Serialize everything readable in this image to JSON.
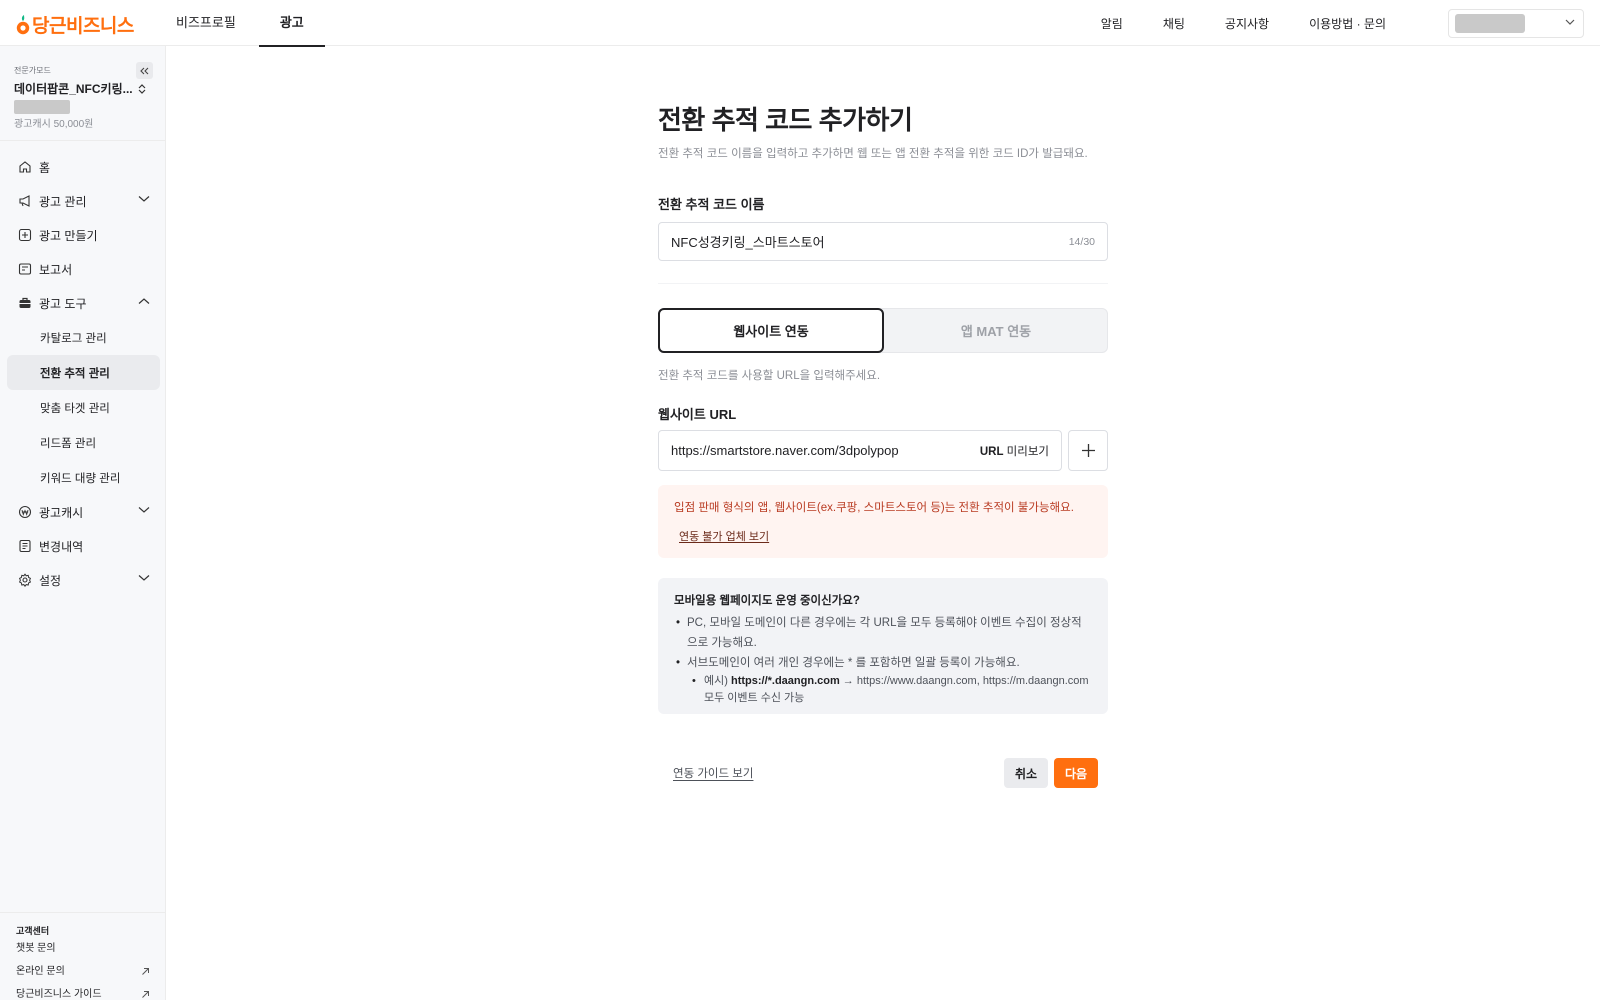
{
  "brand": {
    "name": "당근비즈니스",
    "accent": "#ff6f0f"
  },
  "topnav": {
    "items": [
      "비즈프로필",
      "광고"
    ],
    "active": "광고"
  },
  "toplinks": [
    "알림",
    "채팅",
    "공지사항",
    "이용방법 · 문의"
  ],
  "sidebar": {
    "mode": "전문가모드",
    "account": "데이터팝콘_NFC키링...",
    "cash": "광고캐시 50,000원",
    "menu": {
      "home": "홈",
      "ad_manage": "광고 관리",
      "ad_create": "광고 만들기",
      "report": "보고서",
      "ad_tools": "광고 도구",
      "catalog": "카탈로그 관리",
      "conversion": "전환 추적 관리",
      "target": "맞춤 타겟 관리",
      "leadform": "리드폼 관리",
      "keyword": "키워드 대량 관리",
      "ad_cash": "광고캐시",
      "history": "변경내역",
      "settings": "설정"
    },
    "support": {
      "title": "고객센터",
      "chatbot": "챗봇 문의",
      "online": "온라인 문의",
      "guide": "당근비즈니스 가이드"
    }
  },
  "main": {
    "title": "전환 추적 코드 추가하기",
    "description": "전환 추적 코드 이름을 입력하고 추가하면 웹 또는 앱 전환 추적을 위한 코드 ID가 발급돼요.",
    "name_label": "전환 추적 코드 이름",
    "name_value": "NFC성경키링_스마트스토어",
    "name_count": "14/30",
    "tabs": {
      "website": "웹사이트 연동",
      "app": "앱 MAT 연동"
    },
    "url_hint": "전환 추적 코드를 사용할 URL을 입력해주세요.",
    "url_label": "웹사이트 URL",
    "url_value": "https://smartstore.naver.com/3dpolypop",
    "url_preview_bold": "URL",
    "url_preview_rest": " 미리보기",
    "warning": "입점 판매 형식의 앱, 웹사이트(ex.쿠팡, 스마트스토어 등)는 전환 추적이 불가능해요.",
    "warning_link": "연동 불가 업체 보기",
    "info_title": "모바일용 웹페이지도 운영 중이신가요?",
    "info_bullet1": "PC, 모바일 도메인이 다른 경우에는 각 URL을 모두 등록해야 이벤트 수집이 정상적으로 가능해요.",
    "info_bullet2": "서브도메인이 여러 개인 경우에는 * 를 포함하면 일괄 등록이 가능해요.",
    "info_sub_prefix": "예시) ",
    "info_sub_bold": "https://*.daangn.com",
    "info_sub_rest": " → https://www.daangn.com, https://m.daangn.com 모두 이벤트 수신 가능",
    "guide_link": "연동 가이드 보기",
    "cancel": "취소",
    "next": "다음"
  }
}
